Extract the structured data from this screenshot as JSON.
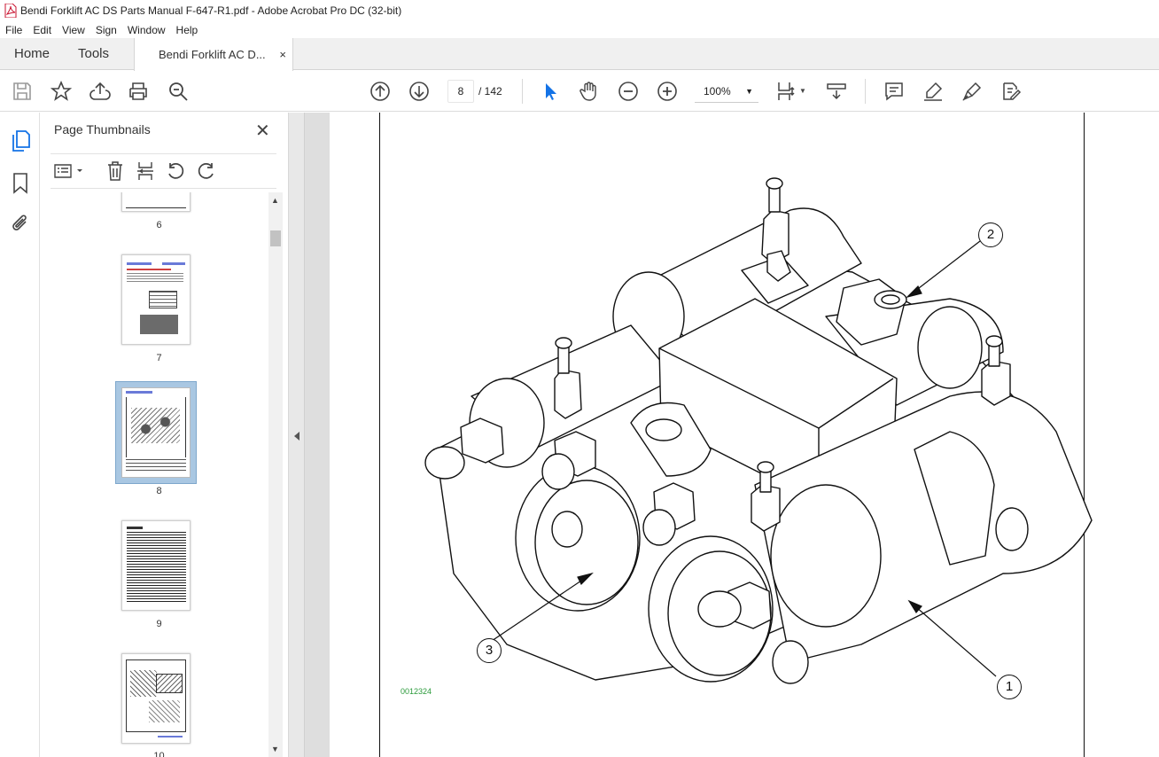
{
  "window": {
    "title": "Bendi Forklift AC DS Parts Manual F-647-R1.pdf - Adobe Acrobat Pro DC (32-bit)"
  },
  "menu": [
    "File",
    "Edit",
    "View",
    "Sign",
    "Window",
    "Help"
  ],
  "tabs": {
    "home": "Home",
    "tools": "Tools",
    "document": "Bendi Forklift AC D...",
    "close": "×"
  },
  "toolbar": {
    "current_page": "8",
    "page_total": "/ 142",
    "zoom": "100%"
  },
  "panel": {
    "title": "Page Thumbnails",
    "close": "✕",
    "thumbnails": [
      {
        "label": "6"
      },
      {
        "label": "7"
      },
      {
        "label": "8",
        "selected": true
      },
      {
        "label": "9"
      },
      {
        "label": "10"
      }
    ]
  },
  "document": {
    "figure_code": "0012324",
    "callouts": [
      "1",
      "2",
      "3"
    ]
  },
  "colors": {
    "accent": "#1473e6",
    "selected_thumb": "#a9c7e2",
    "figure_code": "#2a9a3a"
  }
}
